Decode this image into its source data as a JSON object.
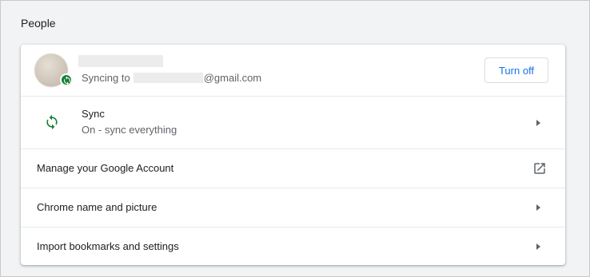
{
  "section": {
    "title": "People"
  },
  "account": {
    "syncing_prefix": "Syncing to",
    "email_domain": "@gmail.com",
    "turn_off_label": "Turn off"
  },
  "rows": [
    {
      "title": "Sync",
      "subtitle": "On - sync everything",
      "icon": "sync-icon",
      "action": "chevron-right-icon"
    },
    {
      "title": "Manage your Google Account",
      "action": "open-in-new-icon"
    },
    {
      "title": "Chrome name and picture",
      "action": "chevron-right-icon"
    },
    {
      "title": "Import bookmarks and settings",
      "action": "chevron-right-icon"
    }
  ],
  "colors": {
    "accent": "#1a73e8",
    "sync_green": "#188038",
    "secondary_text": "#5f6368"
  }
}
